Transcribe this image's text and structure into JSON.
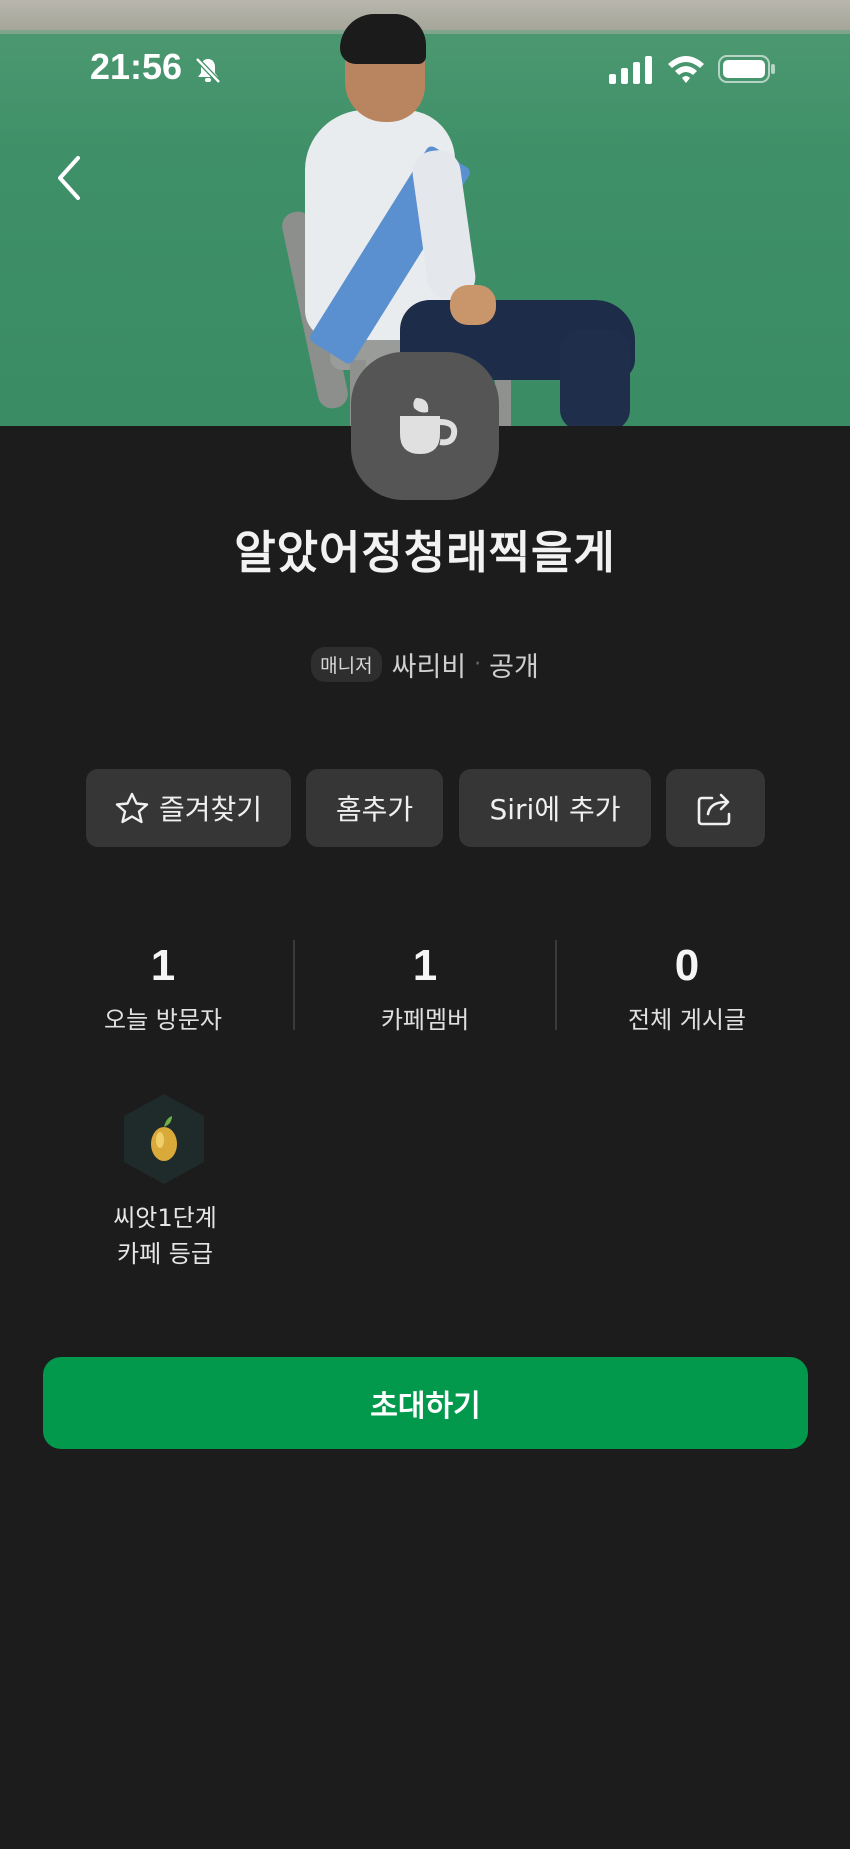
{
  "status_bar": {
    "time": "21:56"
  },
  "cafe": {
    "name": "알았어정청래찍을게",
    "role_badge": "매니저",
    "manager_name": "싸리비",
    "separator": "·",
    "visibility": "공개"
  },
  "actions": {
    "favorite_label": "즐겨찾기",
    "home_add_label": "홈추가",
    "siri_label": "Siri에 추가"
  },
  "stats": [
    {
      "value": "1",
      "label": "오늘 방문자"
    },
    {
      "value": "1",
      "label": "카페멤버"
    },
    {
      "value": "0",
      "label": "전체 게시글"
    }
  ],
  "grade": {
    "level": "씨앗1단계",
    "label": "카페 등급"
  },
  "invite": {
    "label": "초대하기"
  },
  "colors": {
    "background": "#1c1c1c",
    "button": "#363636",
    "accent_green": "#03994d",
    "cafe_icon_bg": "#555555"
  },
  "icons": [
    "bell-slash-icon",
    "signal-icon",
    "wifi-icon",
    "battery-icon",
    "chevron-left-icon",
    "coffee-cup-icon",
    "star-icon",
    "share-icon",
    "seed-grade-icon"
  ]
}
